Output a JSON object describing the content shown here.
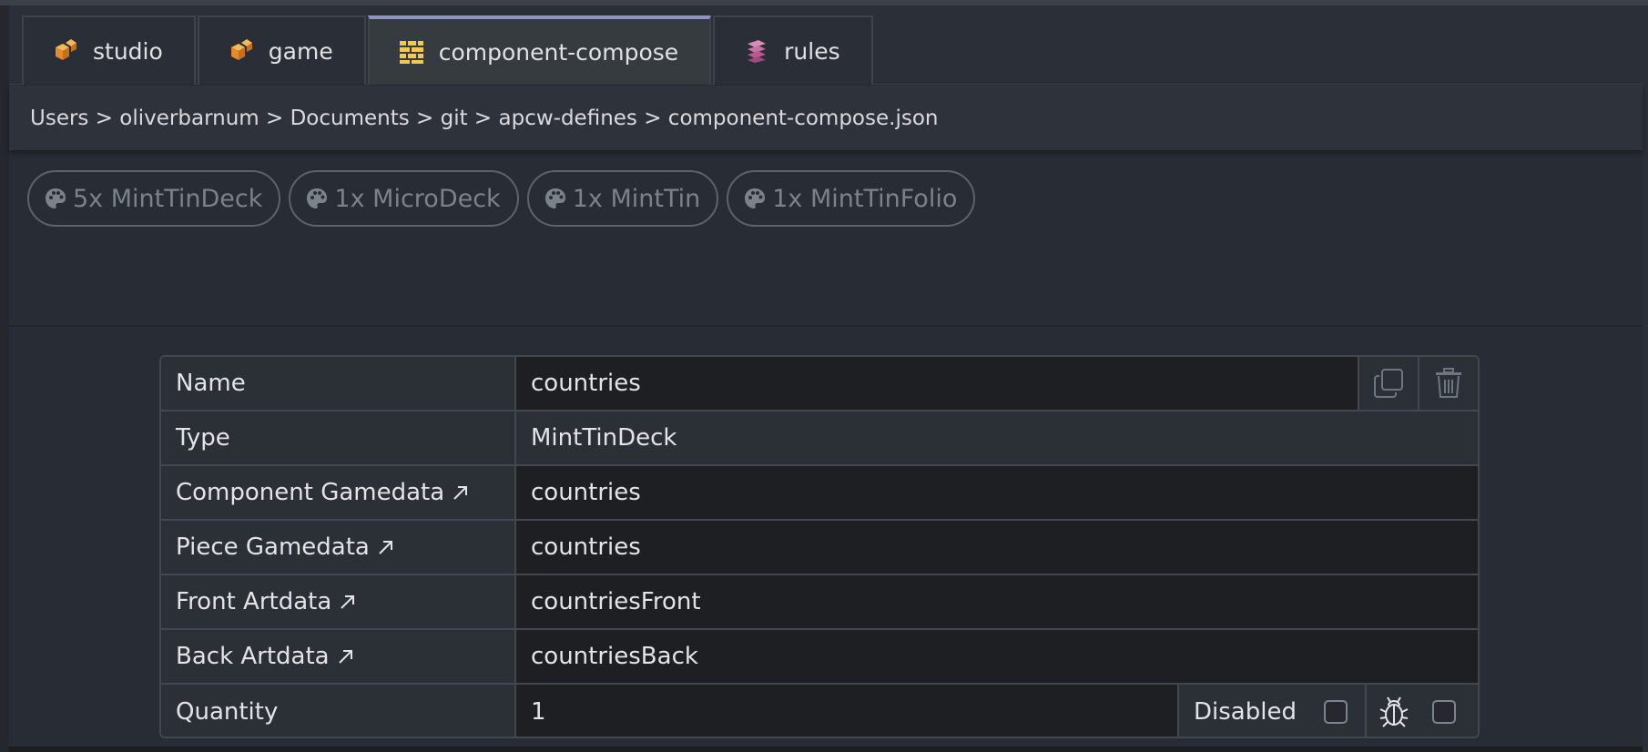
{
  "tabs": [
    {
      "label": "studio",
      "icon": "dice-icon",
      "active": false
    },
    {
      "label": "game",
      "icon": "dice-icon",
      "active": false
    },
    {
      "label": "component-compose",
      "icon": "brick-wall-icon",
      "active": true
    },
    {
      "label": "rules",
      "icon": "rules-icon",
      "active": false
    }
  ],
  "breadcrumb": "Users > oliverbarnum > Documents > git > apcw-defines > component-compose.json",
  "chips": [
    {
      "label": "5x MintTinDeck",
      "icon": "palette-icon"
    },
    {
      "label": "1x MicroDeck",
      "icon": "palette-icon"
    },
    {
      "label": "1x MintTin",
      "icon": "palette-icon"
    },
    {
      "label": "1x MintTinFolio",
      "icon": "palette-icon"
    }
  ],
  "form": {
    "name": {
      "label": "Name",
      "value": "countries"
    },
    "type": {
      "label": "Type",
      "value": "MintTinDeck"
    },
    "component_gamedata": {
      "label": "Component Gamedata",
      "value": "countries"
    },
    "piece_gamedata": {
      "label": "Piece Gamedata",
      "value": "countries"
    },
    "front_artdata": {
      "label": "Front Artdata",
      "value": "countriesFront"
    },
    "back_artdata": {
      "label": "Back Artdata",
      "value": "countriesBack"
    },
    "quantity": {
      "label": "Quantity",
      "value": "1"
    },
    "disabled_label": "Disabled"
  },
  "colors": {
    "accent": "#8d95c8",
    "dice": "#f0a03c",
    "brick": "#f2c94c",
    "rules": "#c96fa4"
  }
}
